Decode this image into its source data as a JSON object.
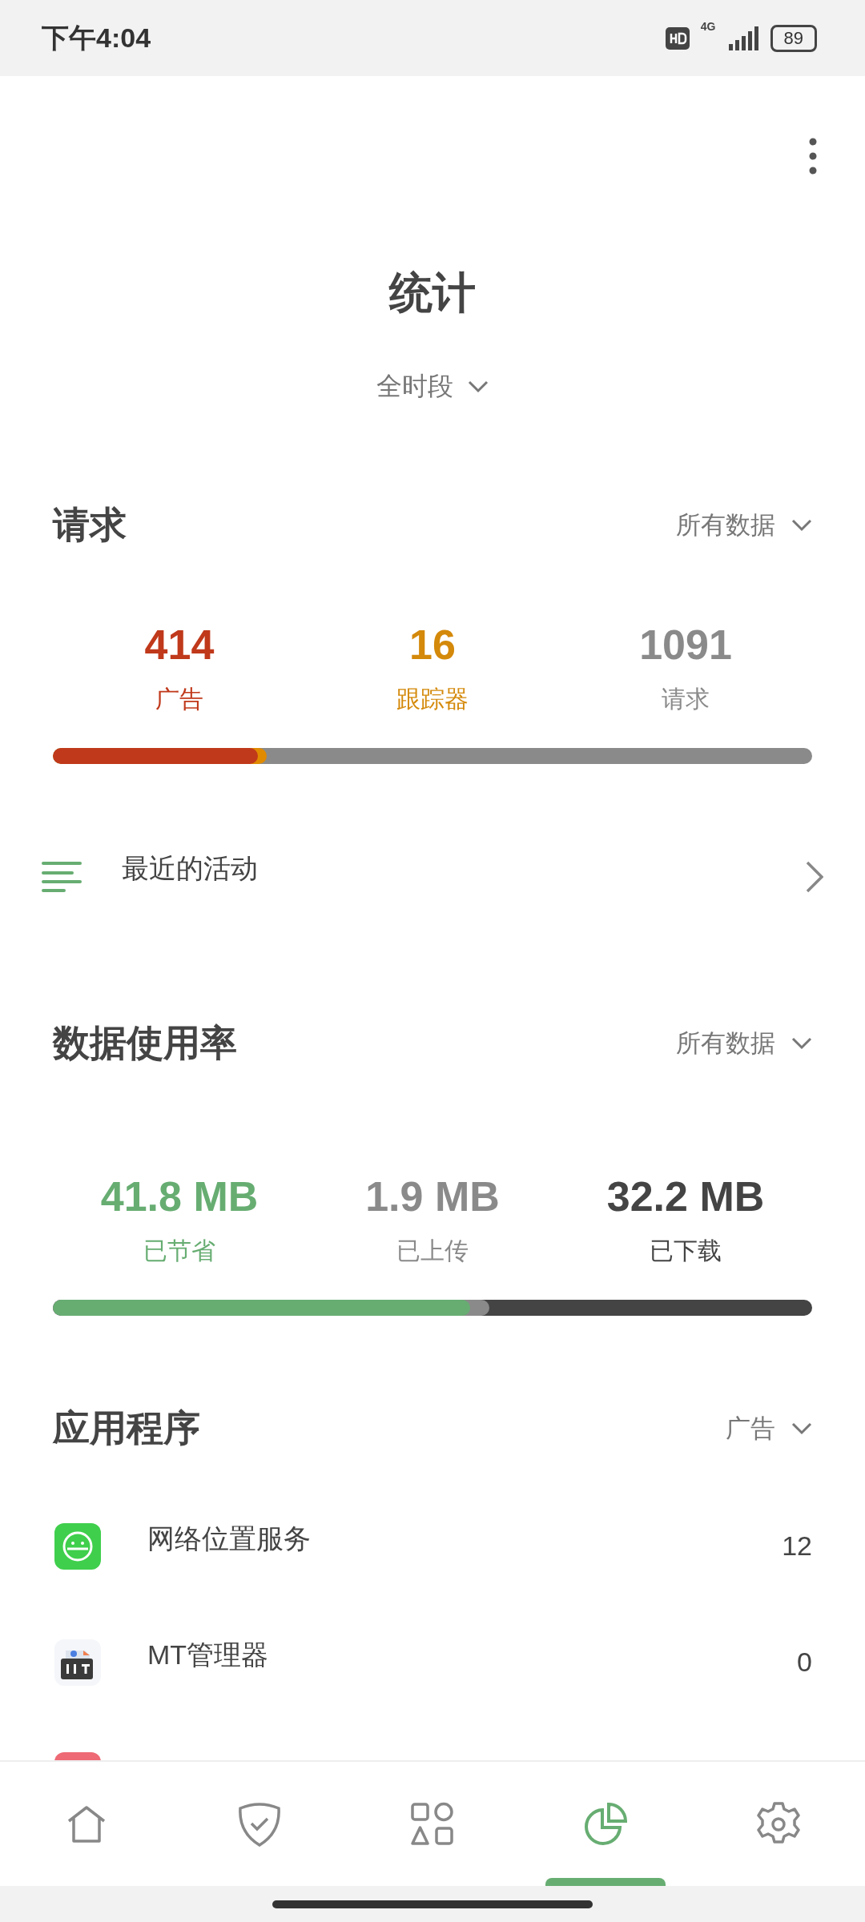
{
  "status_bar": {
    "time": "下午4:04",
    "network": "4G",
    "battery": "89"
  },
  "header": {
    "title": "统计",
    "period": "全时段"
  },
  "requests": {
    "title": "请求",
    "filter": "所有数据",
    "stats": [
      {
        "value": "414",
        "label": "广告",
        "color": "#c0391b"
      },
      {
        "value": "16",
        "label": "跟踪器",
        "color": "#d4890a"
      },
      {
        "value": "1091",
        "label": "请求",
        "color": "#8a8a8a"
      }
    ],
    "bar": {
      "color": "#8a8a8a",
      "fills": [
        {
          "level": 0.282,
          "color": "#e08a00"
        },
        {
          "level": 0.27,
          "color": "#c0391b"
        }
      ]
    }
  },
  "recent_activity": {
    "label": "最近的活动"
  },
  "data_usage": {
    "title": "数据使用率",
    "filter": "所有数据",
    "stats": [
      {
        "value": "41.8 MB",
        "label": "已节省",
        "color": "#67ad72"
      },
      {
        "value": "1.9 MB",
        "label": "已上传",
        "color": "#8a8a8a"
      },
      {
        "value": "32.2 MB",
        "label": "已下载",
        "color": "#444444"
      }
    ],
    "bar": {
      "color": "#444444",
      "fills": [
        {
          "level": 0.575,
          "color": "#8a8a8a"
        },
        {
          "level": 0.55,
          "color": "#67ad72"
        }
      ]
    }
  },
  "apps": {
    "title": "应用程序",
    "filter": "广告",
    "items": [
      {
        "kind": "face",
        "name": "网络位置服务",
        "count": "12"
      },
      {
        "kind": "mt",
        "name": "MT管理器",
        "count": "0"
      },
      {
        "kind": "partial",
        "color": "#ee6a75"
      }
    ]
  },
  "bottom_nav": [
    {
      "selected": false
    },
    {
      "selected": false
    },
    {
      "selected": false
    },
    {
      "selected": true
    },
    {
      "selected": false
    }
  ]
}
